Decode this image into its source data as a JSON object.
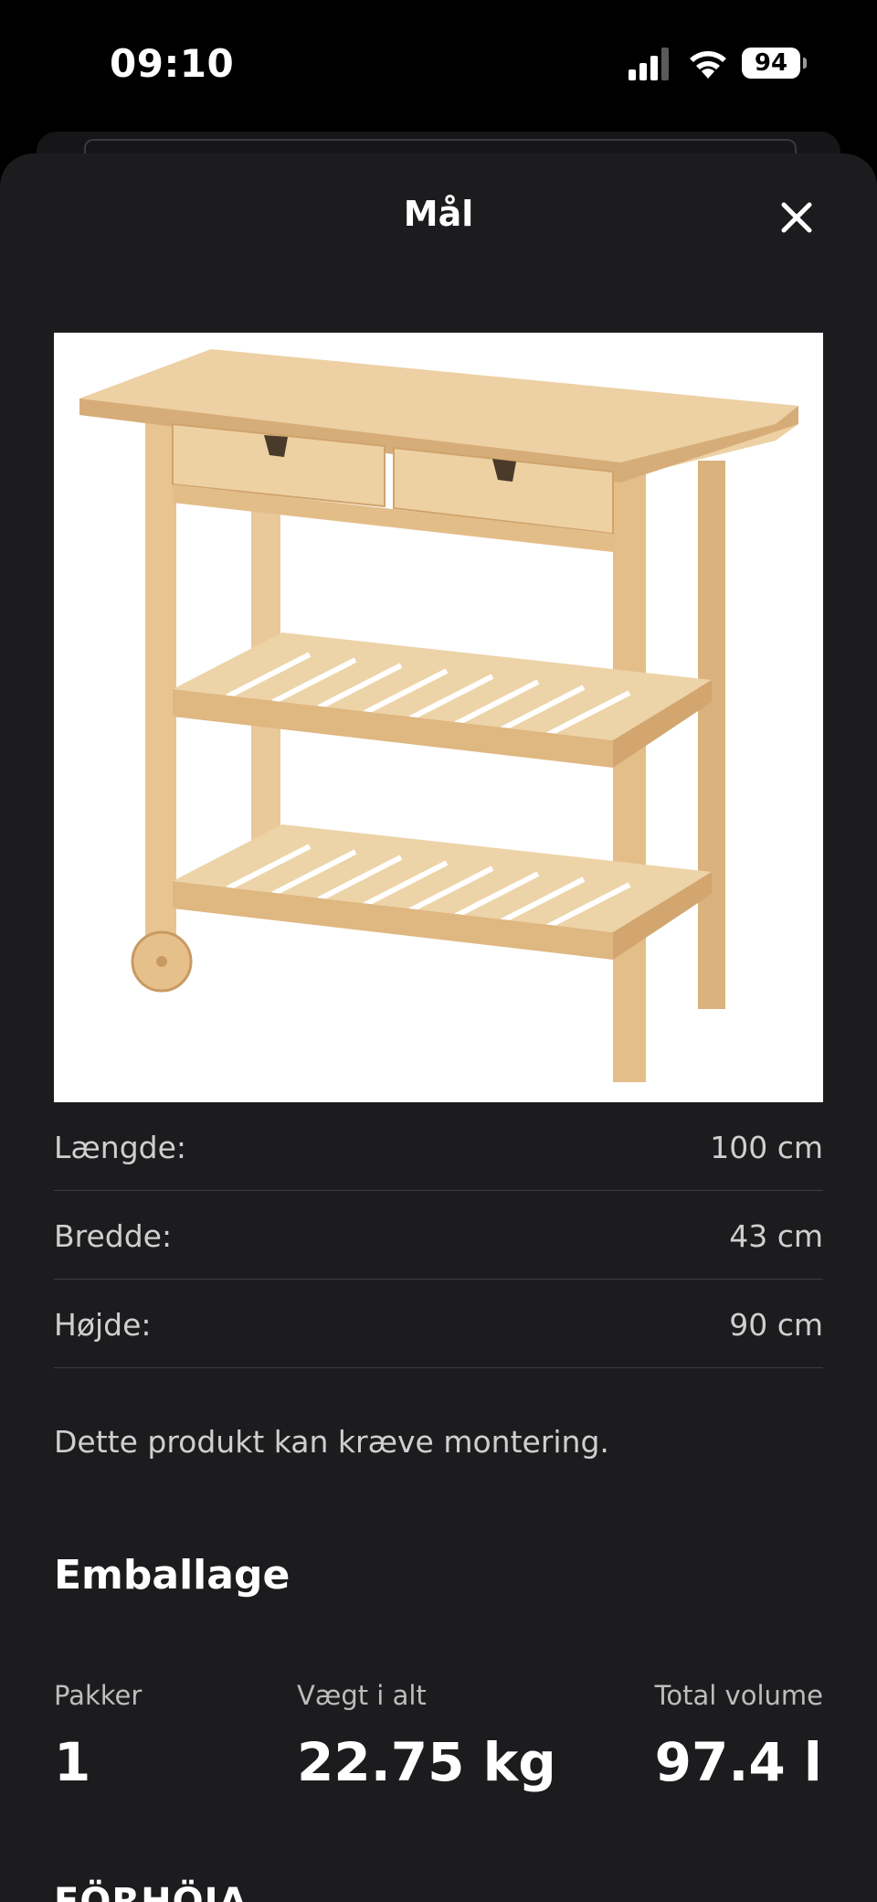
{
  "status_bar": {
    "time": "09:10",
    "battery": "94",
    "icons": [
      "cellular-signal-icon",
      "wifi-icon",
      "battery-icon"
    ]
  },
  "sheet": {
    "title": "Mål",
    "close_icon": "close-icon"
  },
  "product_image": {
    "description_icon": "product-photo"
  },
  "dimensions": [
    {
      "label": "Længde:",
      "value": "100 cm"
    },
    {
      "label": "Bredde:",
      "value": "43 cm"
    },
    {
      "label": "Højde:",
      "value": "90 cm"
    }
  ],
  "assembly_note": "Dette produkt kan kræve montering.",
  "packaging": {
    "title": "Emballage",
    "stats": [
      {
        "label": "Pakker",
        "value": "1"
      },
      {
        "label": "Vægt i alt",
        "value": "22.75 kg"
      },
      {
        "label": "Total volume",
        "value": "97.4 l"
      }
    ]
  },
  "next_section_title": "FÖRHÖJA"
}
